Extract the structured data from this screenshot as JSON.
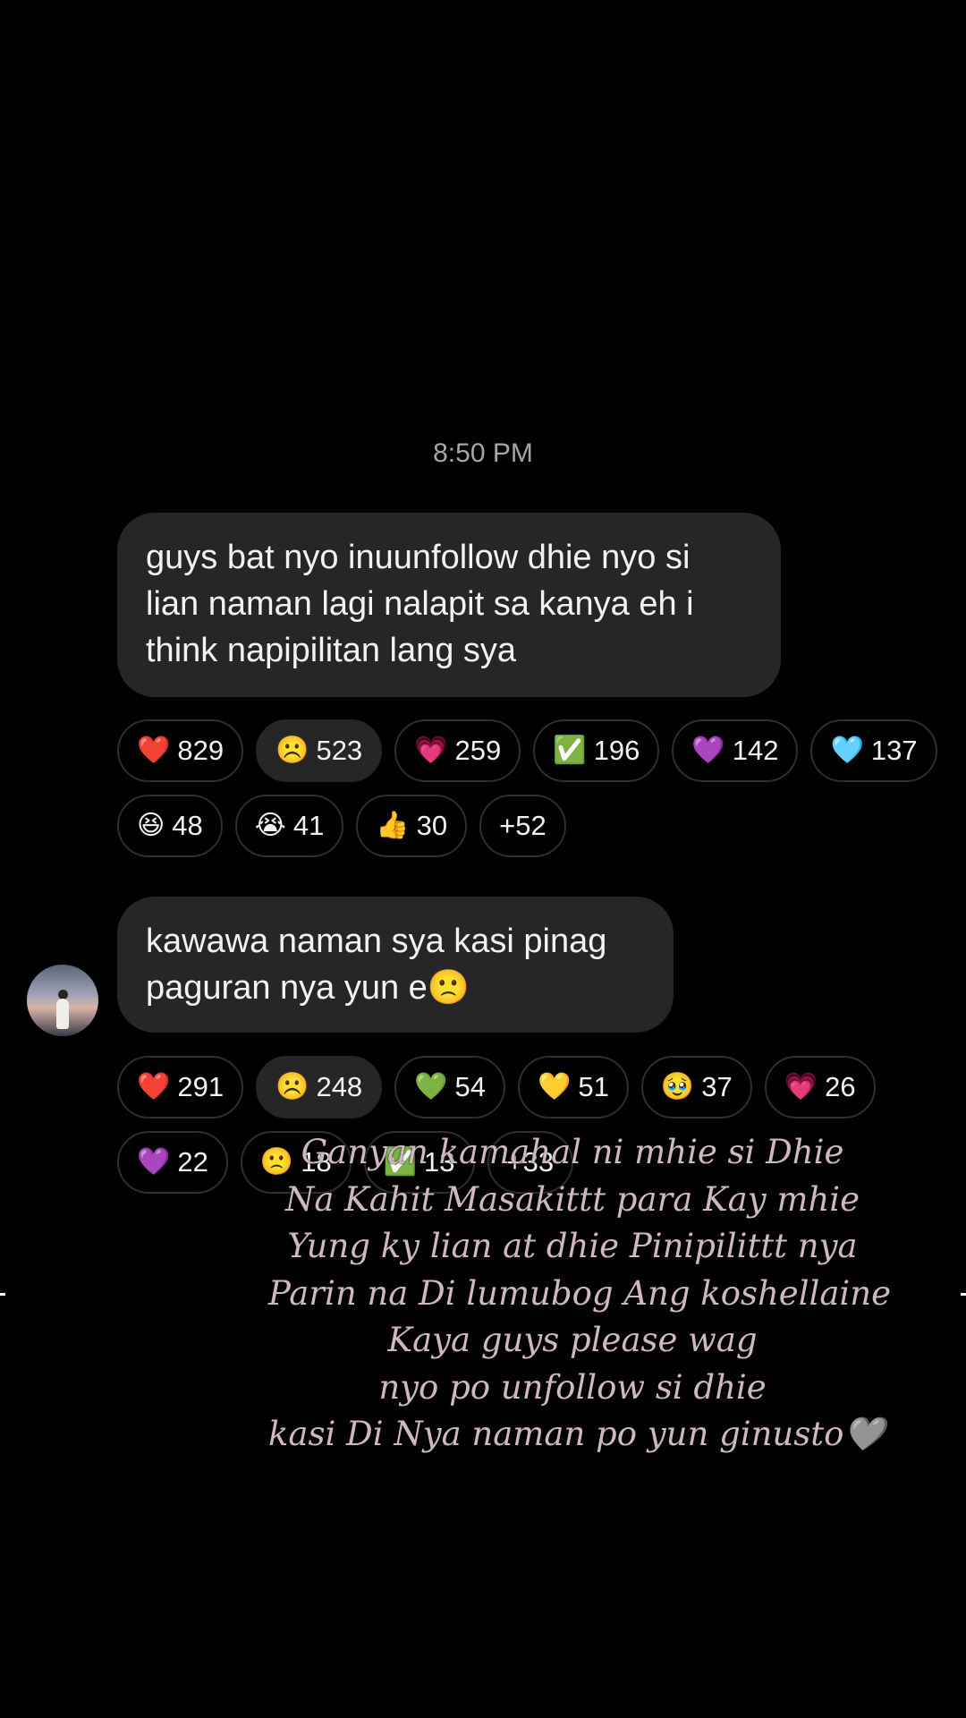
{
  "timestamp": "8:50 PM",
  "messages": [
    {
      "text_lines": [
        "guys bat nyo inuunfollow dhie nyo si",
        "lian naman lagi nalapit sa kanya eh i",
        "think napipilitan lang sya"
      ],
      "reactions_row1": [
        {
          "icon": "red-heart-icon",
          "emoji": "❤️",
          "count": "829"
        },
        {
          "icon": "frowning-face-icon",
          "emoji": "☹️",
          "count": "523"
        },
        {
          "icon": "pink-heart-icon",
          "emoji": "💗",
          "count": "259"
        },
        {
          "icon": "check-mark-icon",
          "emoji": "✅",
          "count": "196"
        },
        {
          "icon": "purple-heart-icon",
          "emoji": "💜",
          "count": "142"
        },
        {
          "icon": "light-blue-heart-icon",
          "emoji": "🩵",
          "count": "137"
        }
      ],
      "reactions_row2": [
        {
          "icon": "laughing-face-icon",
          "emoji": "😆",
          "count": "48"
        },
        {
          "icon": "crying-face-icon",
          "emoji": "😭",
          "count": "41"
        },
        {
          "icon": "thumbs-up-icon",
          "emoji": "👍",
          "count": "30"
        },
        {
          "more": "+52"
        }
      ]
    },
    {
      "text_lines": [
        "kawawa naman sya kasi pinag",
        "paguran nya yun e🙁"
      ],
      "reactions_row1": [
        {
          "icon": "red-heart-icon",
          "emoji": "❤️",
          "count": "291"
        },
        {
          "icon": "frowning-face-icon",
          "emoji": "☹️",
          "count": "248"
        },
        {
          "icon": "green-heart-icon",
          "emoji": "💚",
          "count": "54"
        },
        {
          "icon": "yellow-heart-icon",
          "emoji": "💛",
          "count": "51"
        },
        {
          "icon": "pleading-face-icon",
          "emoji": "🥹",
          "count": "37"
        },
        {
          "icon": "pink-heart-icon",
          "emoji": "💗",
          "count": "26"
        }
      ],
      "reactions_row2": [
        {
          "icon": "purple-heart-icon",
          "emoji": "💜",
          "count": "22"
        },
        {
          "icon": "slightly-frowning-face-icon",
          "emoji": "🙁",
          "count": "18"
        },
        {
          "icon": "check-mark-icon",
          "emoji": "✅",
          "count": "13"
        },
        {
          "more": "+33"
        }
      ]
    }
  ],
  "overlay_text": [
    "Ganyan kamahal ni mhie si Dhie",
    "Na Kahit Masakittt para Kay mhie",
    "Yung ky lian at dhie Pinipilittt nya",
    "Parin na Di lumubog Ang koshellaine",
    "Kaya guys please wag",
    "nyo po unfollow si dhie",
    "kasi Di Nya naman po yun ginusto🩶"
  ],
  "colors": {
    "background": "#000000",
    "bubble": "#262626",
    "chip_border": "#2e2e2e",
    "timestamp": "#a6a6a6",
    "overlay_text": "#cfb8c2"
  }
}
